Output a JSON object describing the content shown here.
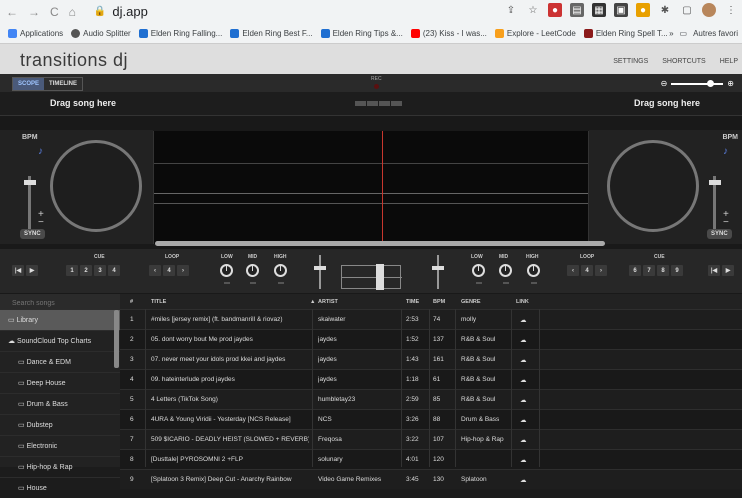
{
  "browser": {
    "url": "dj.app",
    "bookmarks": [
      "Applications",
      "Audio Splitter",
      "Elden Ring Falling...",
      "Elden Ring Best F...",
      "Elden Ring Tips &...",
      "(23) Kiss - I was...",
      "Explore - LeetCode",
      "Elden Ring Spell T..."
    ],
    "more": "»",
    "other": "Autres favori"
  },
  "app": {
    "title": "transitions dj",
    "menu": [
      "SETTINGS",
      "SHORTCUTS",
      "HELP"
    ],
    "tabs": [
      "SCOPE",
      "TIMELINE"
    ],
    "rec": "REC",
    "drop_left": "Drag song here",
    "drop_right": "Drag song here"
  },
  "deck": {
    "bpm": "BPM",
    "sync": "SYNC",
    "plus": "+",
    "minus": "−",
    "cue": "CUE",
    "loop": "LOOP",
    "low": "LOW",
    "mid": "MID",
    "high": "HIGH",
    "cue_left": [
      "1",
      "2",
      "3",
      "4"
    ],
    "cue_right": [
      "6",
      "7",
      "8",
      "9"
    ],
    "loop_val": "4",
    "loop_prev": "‹",
    "loop_next": "›"
  },
  "library": {
    "search_placeholder": "Search songs",
    "sidebar": [
      "Library",
      "SoundCloud Top Charts",
      "Dance & EDM",
      "Deep House",
      "Drum & Bass",
      "Dubstep",
      "Electronic",
      "Hip-hop & Rap",
      "House"
    ],
    "columns": [
      "#",
      "TITLE",
      "ARTIST",
      "TIME",
      "BPM",
      "GENRE",
      "LINK"
    ],
    "rows": [
      [
        "1",
        "#miles [jersey remix] (ft. bandmanrill & riovaz)",
        "skaiwater",
        "2:53",
        "74",
        "molly"
      ],
      [
        "2",
        "05. dont worry bout Me prod jaydes",
        "jaydes",
        "1:52",
        "137",
        "R&B & Soul"
      ],
      [
        "3",
        "07. never meet your idols prod kkei and jaydes",
        "jaydes",
        "1:43",
        "161",
        "R&B & Soul"
      ],
      [
        "4",
        "09. hateinterlude prod jaydes",
        "jaydes",
        "1:18",
        "61",
        "R&B & Soul"
      ],
      [
        "5",
        "4 Letters (TikTok Song)",
        "humbletay23",
        "2:59",
        "85",
        "R&B & Soul"
      ],
      [
        "6",
        "4URA & Young Viridii - Yesterday [NCS Release]",
        "NCS",
        "3:26",
        "88",
        "Drum & Bass"
      ],
      [
        "7",
        "509 $ICARIO - DEADLY HEIST (SLOWED + REVERB)",
        "Freqosa",
        "3:22",
        "107",
        "Hip-hop & Rap"
      ],
      [
        "8",
        "[Dusttale] PYROSOMNI 2 +FLP",
        "solunary",
        "4:01",
        "120",
        ""
      ],
      [
        "9",
        "[Splatoon 3 Remix] Deep Cut - Anarchy Rainbow",
        "Video Game Remixes",
        "3:45",
        "130",
        "Splatoon"
      ]
    ]
  }
}
